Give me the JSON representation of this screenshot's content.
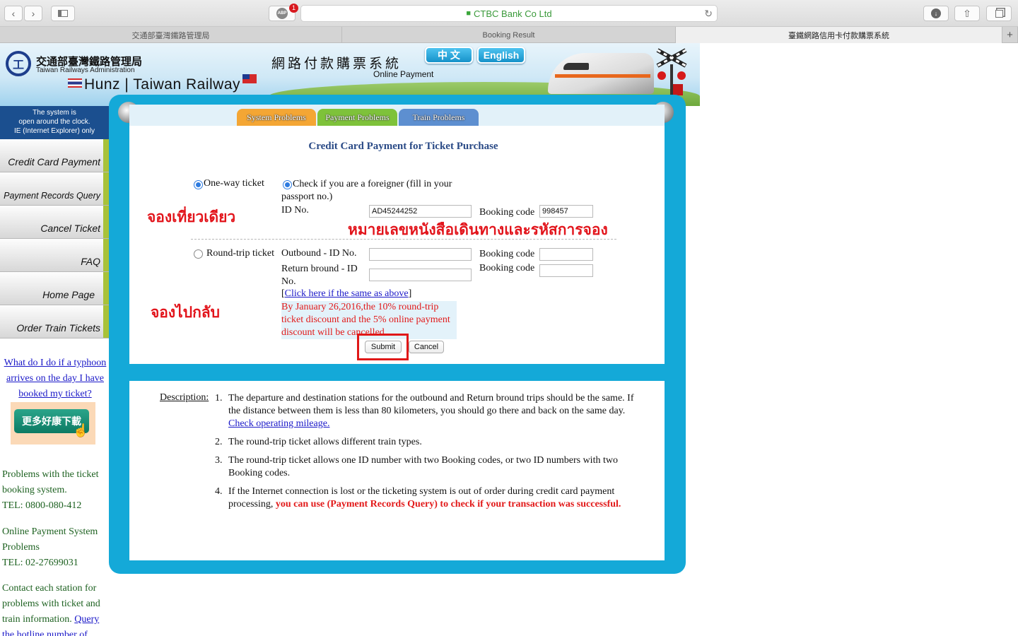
{
  "browser": {
    "url_site": "CTBC Bank Co Ltd",
    "abp_badge": "1",
    "tabs": [
      "交通部臺灣鐵路管理局",
      "Booking Result",
      "臺鐵網路信用卡付款購票系統"
    ],
    "new_tab": "+"
  },
  "header": {
    "org_cn": "交通部臺灣鐵路管理局",
    "org_en": "Taiwan Railways Administration",
    "overlay_title": "Hunz | Taiwan Railway",
    "system_cn": "網路付款購票系統",
    "system_en": "Online Payment",
    "lang_cn": "中 文",
    "lang_en": "English"
  },
  "sidebar": {
    "notice_lines": [
      "The system is",
      "open around the clock.",
      "IE (Internet Explorer) only"
    ],
    "items": [
      "Credit Card Payment",
      "Payment Records Query",
      "Cancel Ticket",
      "FAQ",
      "Home Page",
      "Order Train Tickets"
    ],
    "typhoon_link": "What do I do if a typhoon arrives on the day I have booked my ticket?",
    "download_label": "更多好康下載",
    "problems_ticket": "Problems with the ticket booking system.",
    "tel1": "TEL: 0800-080-412",
    "problems_payment": "Online Payment System Problems",
    "tel2": "TEL: 02-27699031",
    "contact_text": "Contact each station for problems with ticket and train information.",
    "contact_link": "Query the hotline number of"
  },
  "tabs": [
    "System Problems",
    "Payment Problems",
    "Train Problems"
  ],
  "form": {
    "title": "Credit Card Payment for Ticket Purchase",
    "oneway_label": "One-way ticket",
    "foreigner_label": "Check if you are a foreigner (fill in your passport no.)",
    "id_label": "ID No.",
    "id_value": "AD45244252",
    "booking_label": "Booking code",
    "booking_value": "998457",
    "roundtrip_label": "Round-trip ticket",
    "outbound_label": "Outbound - ID No.",
    "outbound_booking_label": "Booking code",
    "return_label": "Return bround - ID No.",
    "return_booking_label": "Booking code",
    "same_link": "Click here if the same as above",
    "notice": "By January 26,2016,the 10% round-trip ticket discount and the 5% online payment discount will be cancelled.",
    "submit": "Submit",
    "cancel": "Cancel"
  },
  "annotations": {
    "oneway_th": "จองเที่ยวเดียว",
    "passport_th": "หมายเลขหนังสือเดินทางและรหัสการจอง",
    "roundtrip_th": "จองไปกลับ"
  },
  "description": {
    "label": "Description:",
    "items": [
      {
        "num": "1.",
        "text": "The departure and destination stations for the outbound and Return bround trips should be the same. If the distance between them is less than 80 kilometers, you should go there and back on the same day.",
        "link": "Check operating mileage."
      },
      {
        "num": "2.",
        "text": "The round-trip ticket allows different train types."
      },
      {
        "num": "3.",
        "text": "The round-trip ticket allows one ID number with two Booking codes, or two ID numbers with two Booking codes."
      },
      {
        "num": "4.",
        "text": "If the Internet connection is lost or the ticketing system is out of order during credit card payment processing,",
        "emphasis": "you can use (Payment Records Query) to check if your transaction was successful."
      }
    ]
  }
}
